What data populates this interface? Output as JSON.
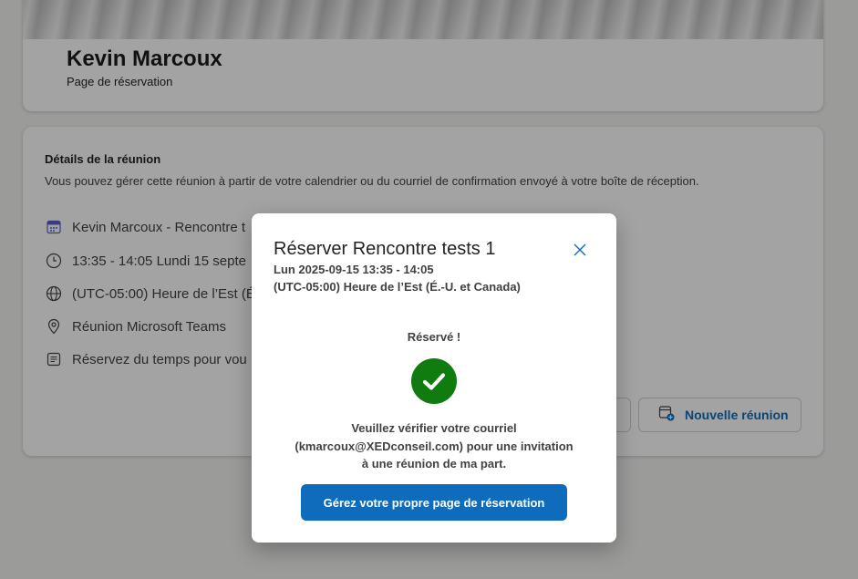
{
  "header": {
    "owner_name": "Kevin Marcoux",
    "subtitle": "Page de réservation"
  },
  "details": {
    "title": "Détails de la réunion",
    "description": "Vous pouvez gérer cette réunion à partir de votre calendrier ou du courriel de confirmation envoyé à votre boîte de réception.",
    "rows": [
      {
        "icon": "calendar-icon",
        "text": "Kevin Marcoux - Rencontre t"
      },
      {
        "icon": "clock-icon",
        "text": "13:35 - 14:05 Lundi 15 septe"
      },
      {
        "icon": "globe-icon",
        "text": "(UTC-05:00) Heure de l’Est (É"
      },
      {
        "icon": "location-icon",
        "text": "Réunion Microsoft Teams"
      },
      {
        "icon": "notes-icon",
        "text": "Réservez du temps pour vou"
      }
    ],
    "new_meeting_label": "Nouvelle réunion"
  },
  "dialog": {
    "title": "Réserver Rencontre tests 1",
    "date_line": "Lun 2025-09-15 13:35 - 14:05",
    "tz_line": "(UTC-05:00) Heure de l’Est (É.-U. et Canada)",
    "status": "Réservé !",
    "confirm_line1": "Veuillez vérifier votre courriel",
    "confirm_line2": "(kmarcoux@XEDconseil.com) pour une invitation",
    "confirm_line3": "à une réunion de ma part.",
    "manage_button": "Gérez votre propre page de réservation"
  },
  "colors": {
    "accent": "#0f6cbd",
    "success": "#107c10",
    "overlay": "rgba(0,0,0,0.36)"
  }
}
